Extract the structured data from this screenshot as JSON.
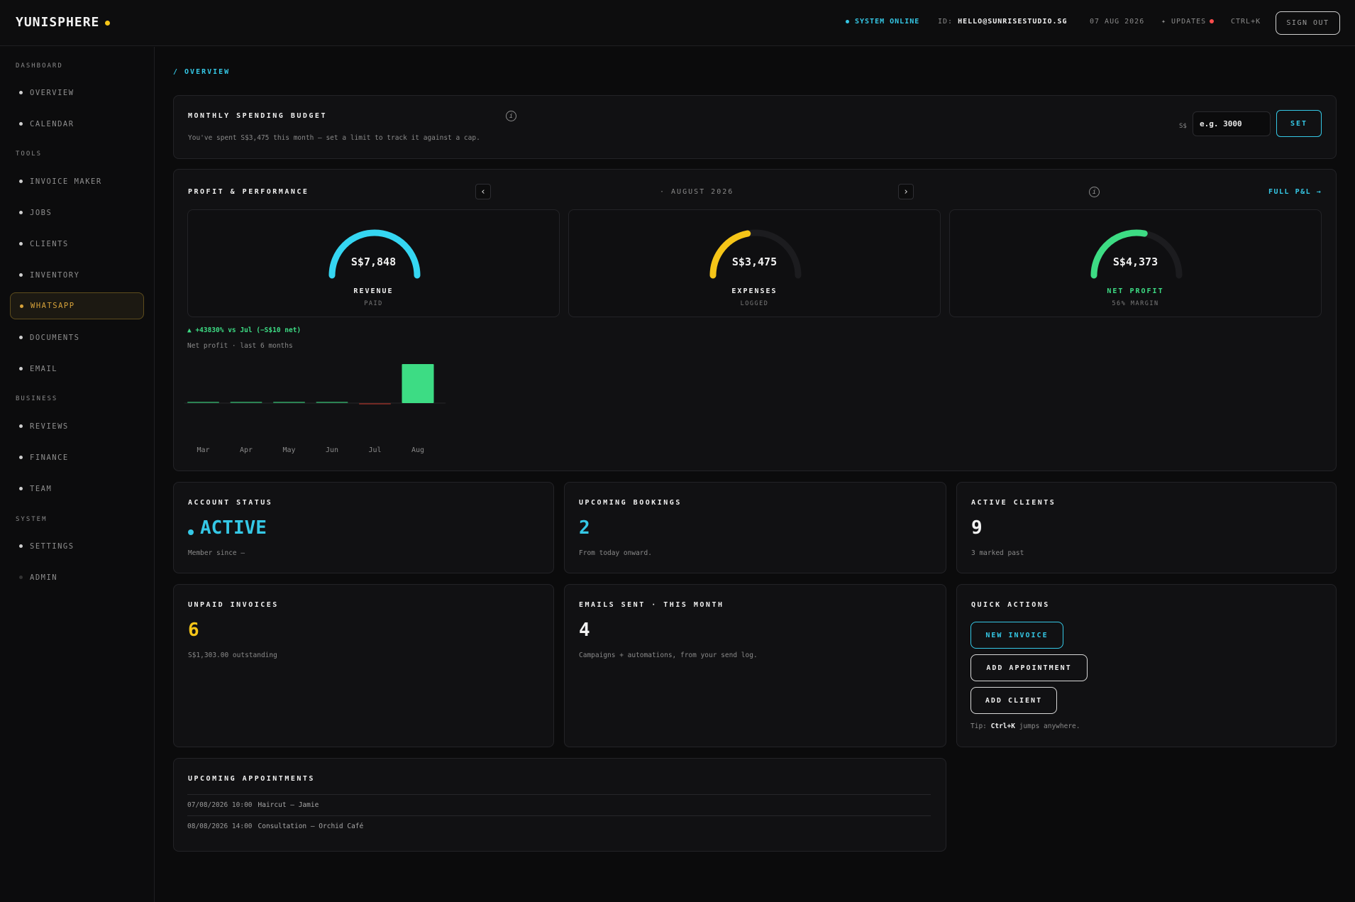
{
  "header": {
    "logo": "YUNISPHERE",
    "status": "SYSTEM ONLINE",
    "id_label": "ID:",
    "id_value": "HELLO@SUNRISESTUDIO.SG",
    "date": "07 AUG 2026",
    "updates": "✦ UPDATES",
    "shortcut": "CTRL+K",
    "signout": "SIGN OUT"
  },
  "sidebar": {
    "sections": [
      {
        "label": "DASHBOARD"
      },
      {
        "label": "TOOLS"
      },
      {
        "label": "BUSINESS"
      },
      {
        "label": "SYSTEM"
      }
    ],
    "items": [
      {
        "label": "OVERVIEW"
      },
      {
        "label": "CALENDAR"
      },
      {
        "label": "INVOICE MAKER"
      },
      {
        "label": "JOBS"
      },
      {
        "label": "CLIENTS"
      },
      {
        "label": "INVENTORY"
      },
      {
        "label": "WHATSAPP"
      },
      {
        "label": "DOCUMENTS"
      },
      {
        "label": "EMAIL"
      },
      {
        "label": "REVIEWS"
      },
      {
        "label": "FINANCE"
      },
      {
        "label": "TEAM"
      },
      {
        "label": "SETTINGS"
      },
      {
        "label": "ADMIN"
      }
    ],
    "active": "WHATSAPP"
  },
  "breadcrumb": "/ OVERVIEW",
  "budget": {
    "title": "MONTHLY SPENDING BUDGET",
    "info": "i",
    "description": "You've spent S$3,475 this month — set a limit to track it against a cap.",
    "currency": "S$",
    "placeholder": "e.g. 3000",
    "set_label": "SET"
  },
  "performance": {
    "title": "PROFIT & PERFORMANCE",
    "prev": "‹",
    "next": "›",
    "month": "· AUGUST 2026",
    "info": "i",
    "full_pl": "FULL P&L →",
    "gauges": [
      {
        "value": "S$7,848",
        "label": "REVENUE",
        "sub": "PAID",
        "fraction": 1.0,
        "color": "#35d6f2",
        "label_color": "#f0f0f0"
      },
      {
        "value": "S$3,475",
        "label": "EXPENSES",
        "sub": "LOGGED",
        "fraction": 0.44,
        "color": "#f5c518",
        "label_color": "#f0f0f0"
      },
      {
        "value": "S$4,373",
        "label": "NET PROFIT",
        "sub": "56% MARGIN",
        "fraction": 0.56,
        "color": "#3ddc84",
        "label_color": "#3ddc84"
      }
    ],
    "trend": "▲ +43830% vs Jul (−S$10 net)",
    "chart_subtitle": "Net profit · last 6 months"
  },
  "chart_data": {
    "type": "bar",
    "categories": [
      "Mar",
      "Apr",
      "May",
      "Jun",
      "Jul",
      "Aug"
    ],
    "values": [
      0,
      0,
      0,
      0,
      -10,
      4373
    ],
    "positive_color": "#3ddc84",
    "negative_color": "#c0392b"
  },
  "stats": {
    "account": {
      "title": "ACCOUNT STATUS",
      "value": "ACTIVE",
      "sub": "Member since —"
    },
    "bookings": {
      "title": "UPCOMING BOOKINGS",
      "value": "2",
      "sub": "From today onward."
    },
    "clients": {
      "title": "ACTIVE CLIENTS",
      "value": "9",
      "sub": "3 marked past"
    },
    "invoices": {
      "title": "UNPAID INVOICES",
      "value": "6",
      "sub": "S$1,303.00 outstanding"
    },
    "emails": {
      "title": "EMAILS SENT · THIS MONTH",
      "value": "4",
      "sub": "Campaigns + automations, from your send log."
    }
  },
  "quick_actions": {
    "title": "QUICK ACTIONS",
    "new_invoice": "NEW INVOICE",
    "add_appointment": "ADD APPOINTMENT",
    "add_client": "ADD CLIENT",
    "tip_prefix": "Tip:",
    "tip_key": "Ctrl+K",
    "tip_suffix": "jumps anywhere."
  },
  "appointments": {
    "title": "UPCOMING APPOINTMENTS",
    "rows": [
      {
        "datetime": "07/08/2026 10:00",
        "desc": "Haircut — Jamie"
      },
      {
        "datetime": "08/08/2026 14:00",
        "desc": "Consultation — Orchid Café"
      }
    ]
  }
}
